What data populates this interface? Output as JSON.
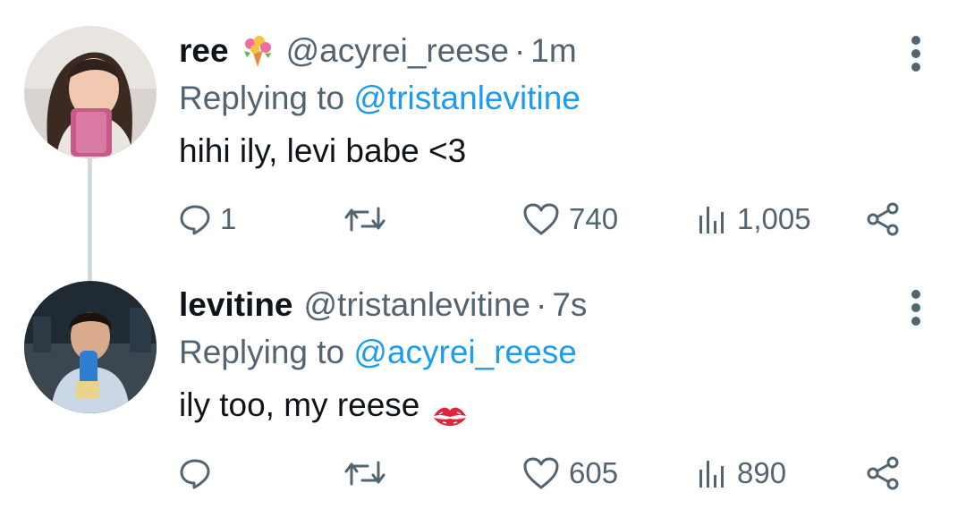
{
  "tweets": [
    {
      "name": "ree",
      "handle": "@acyrei_reese",
      "separator": "·",
      "time": "1m",
      "replying_prefix": "Replying to",
      "replying_to": "@tristanlevitine",
      "text": "hihi ily, levi babe <3",
      "name_emoji": "bouquet-emoji",
      "text_emoji": null,
      "metrics": {
        "replies": "1",
        "retweets": "",
        "likes": "740",
        "views": "1,005"
      }
    },
    {
      "name": "levitine",
      "handle": "@tristanlevitine",
      "separator": "·",
      "time": "7s",
      "replying_prefix": "Replying to",
      "replying_to": "@acyrei_reese",
      "text": "ily too, my reese",
      "name_emoji": null,
      "text_emoji": "kiss-mark-emoji",
      "metrics": {
        "replies": "",
        "retweets": "",
        "likes": "605",
        "views": "890"
      }
    }
  ],
  "colors": {
    "text": "#0f1419",
    "secondary": "#536471",
    "link": "#1d9bf0",
    "thread_line": "#cfd9de"
  }
}
